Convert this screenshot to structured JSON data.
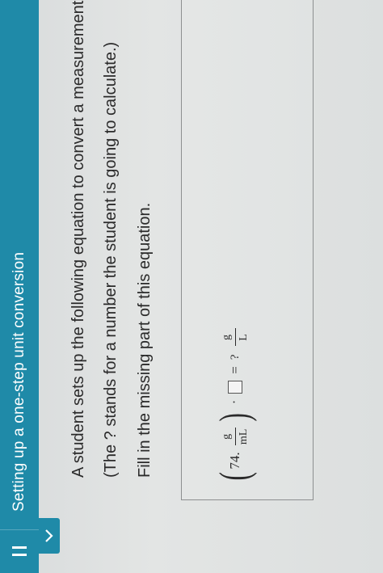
{
  "header": {
    "title": "Setting up a one-step unit conversion",
    "menu_icon": "hamburger-menu-icon",
    "accent_color": "#1f8aa8"
  },
  "collapse_tab": {
    "icon": "chevron-down-icon"
  },
  "question": {
    "line1": "A student sets up the following equation to convert a measurement.",
    "line2": "(The ? stands for a number the student is going to calculate.)",
    "line3": "Fill in the missing part of this equation."
  },
  "equation": {
    "value": "74.",
    "unit_num": "g",
    "unit_den": "mL",
    "dot": "·",
    "equals": "=",
    "question_mark": "?",
    "result_num": "g",
    "result_den": "L"
  }
}
